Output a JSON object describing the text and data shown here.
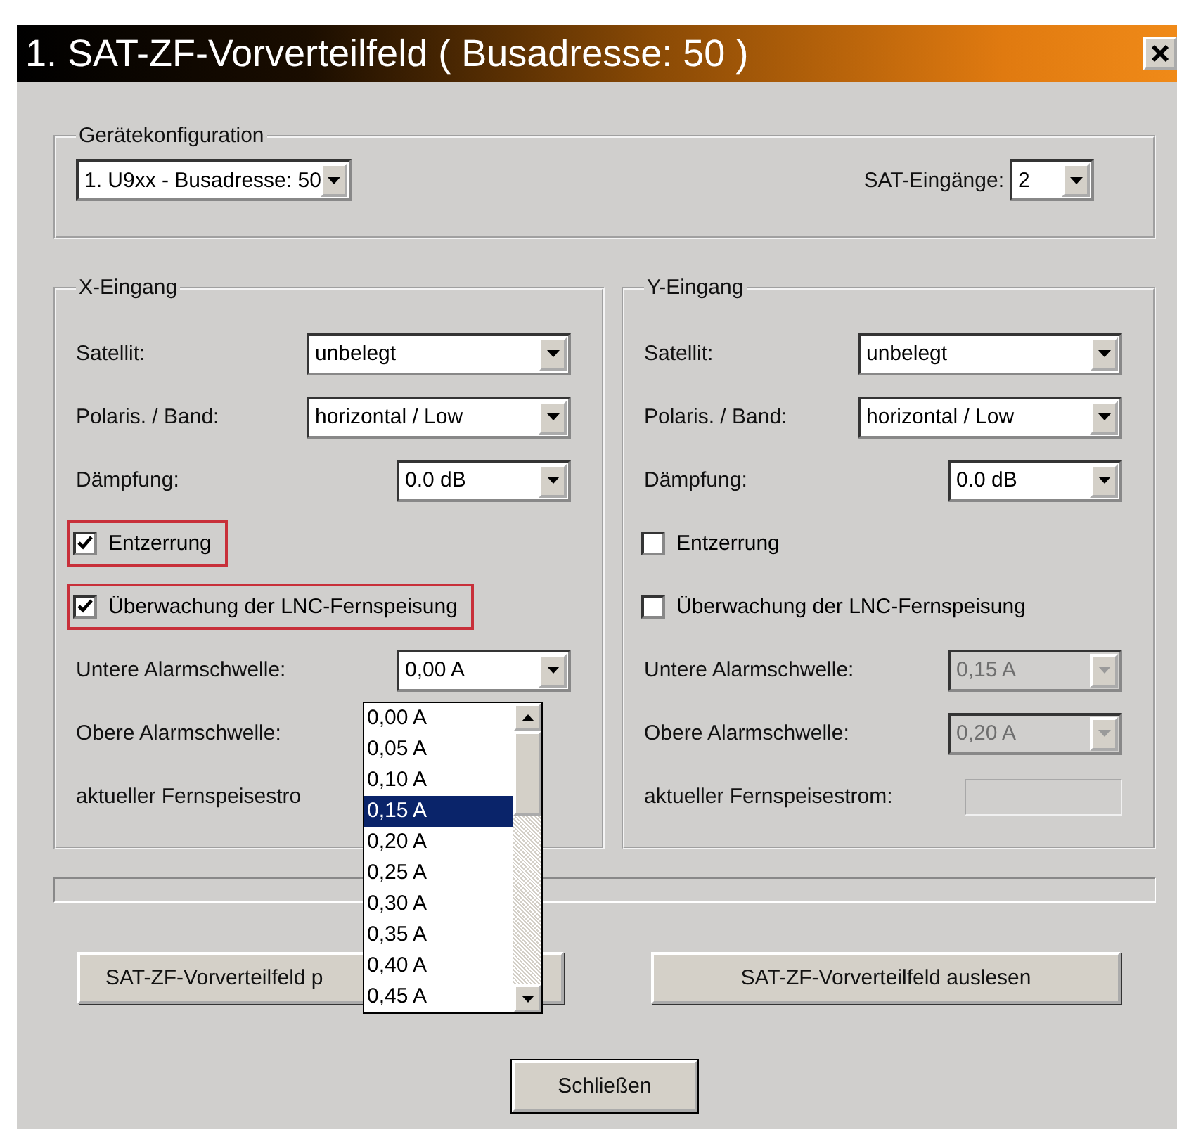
{
  "window": {
    "title": "1. SAT-ZF-Vorverteilfeld ( Busadresse: 50 )"
  },
  "device_config": {
    "legend": "Gerätekonfiguration",
    "device": "1. U9xx - Busadresse: 50",
    "inputs_label": "SAT-Eingänge:",
    "inputs": "2"
  },
  "inputs": [
    {
      "legend": "X-Eingang",
      "rows": [
        {
          "kind": "wide_combo",
          "label": "Satellit:",
          "value": "unbelegt",
          "disabled": false
        },
        {
          "kind": "wide_combo",
          "label": "Polaris. / Band:",
          "value": "horizontal / Low",
          "disabled": false
        },
        {
          "kind": "combo",
          "label": "Dämpfung:",
          "value": "0.0 dB",
          "disabled": false
        },
        {
          "kind": "checkbox",
          "label": "Entzerrung",
          "checked": true,
          "highlighted": true
        },
        {
          "kind": "checkbox",
          "label": "Überwachung der LNC-Fernspeisung",
          "checked": true,
          "highlighted": true
        },
        {
          "kind": "combo",
          "label": "Untere Alarmschwelle:",
          "value": "0,00 A",
          "disabled": false
        },
        {
          "kind": "label",
          "label": "Obere Alarmschwelle:"
        },
        {
          "kind": "label",
          "label": "aktueller Fernspeisestro"
        }
      ],
      "open_list": {
        "items": [
          {
            "label": "0,00 A",
            "selected": false
          },
          {
            "label": "0,05 A",
            "selected": false
          },
          {
            "label": "0,10 A",
            "selected": false
          },
          {
            "label": "0,15 A",
            "selected": true
          },
          {
            "label": "0,20 A",
            "selected": false
          },
          {
            "label": "0,25 A",
            "selected": false
          },
          {
            "label": "0,30 A",
            "selected": false
          },
          {
            "label": "0,35 A",
            "selected": false
          },
          {
            "label": "0,40 A",
            "selected": false
          },
          {
            "label": "0,45 A",
            "selected": false
          }
        ]
      }
    },
    {
      "legend": "Y-Eingang",
      "rows": [
        {
          "kind": "wide_combo",
          "label": "Satellit:",
          "value": "unbelegt",
          "disabled": false
        },
        {
          "kind": "wide_combo",
          "label": "Polaris. / Band:",
          "value": "horizontal / Low",
          "disabled": false
        },
        {
          "kind": "combo",
          "label": "Dämpfung:",
          "value": "0.0 dB",
          "disabled": false
        },
        {
          "kind": "checkbox",
          "label": "Entzerrung",
          "checked": false,
          "highlighted": false
        },
        {
          "kind": "checkbox",
          "label": "Überwachung der LNC-Fernspeisung",
          "checked": false,
          "highlighted": false
        },
        {
          "kind": "combo",
          "label": "Untere Alarmschwelle:",
          "value": "0,15 A",
          "disabled": true
        },
        {
          "kind": "combo",
          "label": "Obere Alarmschwelle:",
          "value": "0,20 A",
          "disabled": true
        },
        {
          "kind": "readout",
          "label": "aktueller Fernspeisestrom:"
        }
      ]
    }
  ],
  "progress": {
    "level": 0
  },
  "buttons": [
    "SAT-ZF-Vorverteilfeld p",
    "SAT-ZF-Vorverteilfeld auslesen"
  ],
  "close_button": "Schließen"
}
